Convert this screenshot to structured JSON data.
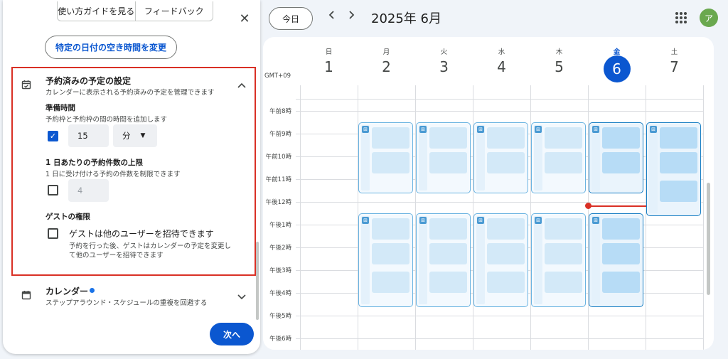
{
  "panel": {
    "tabs": [
      "使い方ガイドを見る",
      "フィードバック"
    ],
    "close_icon": "close-icon",
    "change_button": "特定の日付の空き時間を変更",
    "booked": {
      "title": "予約済みの予定の設定",
      "subtitle": "カレンダーに表示される予約済みの予定を管理できます",
      "buffer": {
        "title": "準備時間",
        "desc": "予約枠と予約枠の間の時間を追加します",
        "checked": true,
        "value": "15",
        "unit": "分"
      },
      "limit": {
        "title": "1 日あたりの予約件数の上限",
        "desc": "1 日に受け付ける予約の件数を制限できます",
        "checked": false,
        "value": "4"
      },
      "guest": {
        "title": "ゲストの権限",
        "option": "ゲストは他のユーザーを招待できます",
        "desc_line1": "予約を行った後、ゲストはカレンダーの予定を変更し",
        "desc_line2": "て他のユーザーを招待できます",
        "checked": false
      }
    },
    "calendar_section": {
      "title": "カレンダー",
      "subtitle": "ステップアラウンド・スケジュールの重複を回避する",
      "dot_color": "#1a73e8"
    },
    "next_button": "次へ"
  },
  "header": {
    "today": "今日",
    "prev_icon": "chevron-left-icon",
    "next_icon": "chevron-right-icon",
    "month": "2025年 6月",
    "apps_icon": "apps-grid-icon",
    "avatar": "ア"
  },
  "calendar": {
    "timezone": "GMT+09",
    "days": [
      {
        "name": "日",
        "num": "1"
      },
      {
        "name": "月",
        "num": "2"
      },
      {
        "name": "火",
        "num": "3"
      },
      {
        "name": "水",
        "num": "4"
      },
      {
        "name": "木",
        "num": "5"
      },
      {
        "name": "金",
        "num": "6",
        "current": true
      },
      {
        "name": "土",
        "num": "7"
      }
    ],
    "times": [
      "午前8時",
      "午前9時",
      "午前10時",
      "午前11時",
      "午後12時",
      "午後1時",
      "午後2時",
      "午後3時",
      "午後4時",
      "午後5時",
      "午後6時"
    ],
    "accent": "#0b57d0",
    "now_color": "#d93025"
  }
}
